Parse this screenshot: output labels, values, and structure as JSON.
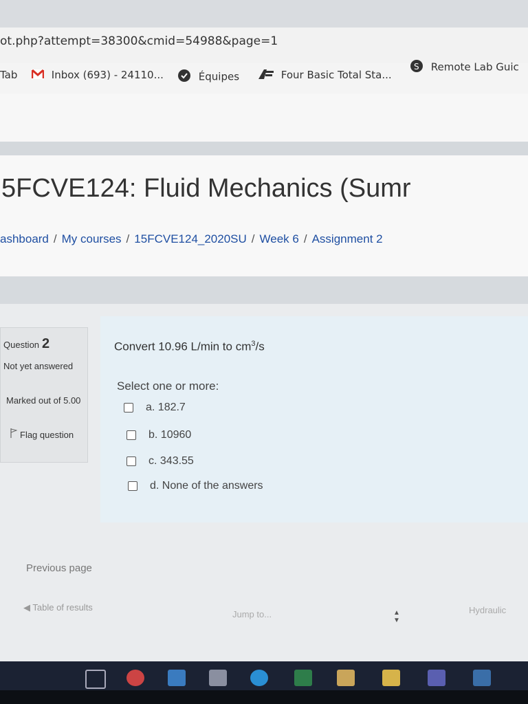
{
  "browser": {
    "url_fragment": "ot.php?attempt=38300&cmid=54988&page=1",
    "bookmarks": [
      {
        "label": "Tab",
        "icon": "none"
      },
      {
        "label": "Inbox (693) - 24110...",
        "icon": "gmail-icon"
      },
      {
        "label": "Équipes",
        "icon": "teams-icon"
      },
      {
        "label": "Four Basic Total Sta...",
        "icon": "bookmark-logo-icon"
      },
      {
        "label": "Remote Lab Guic",
        "icon": "sharepoint-icon"
      }
    ]
  },
  "course": {
    "title": "5FCVE124: Fluid Mechanics (Sumr",
    "breadcrumb": [
      "ashboard",
      "My courses",
      "15FCVE124_2020SU",
      "Week 6",
      "Assignment 2"
    ]
  },
  "question_info": {
    "label": "Question",
    "number": "2",
    "state": "Not yet answered",
    "marks": "Marked out of 5.00",
    "flag": "Flag question"
  },
  "question": {
    "text_before": "Convert 10.96 L/min to cm",
    "superscript": "3",
    "text_after": "/s",
    "prompt": "Select one or more:",
    "options": [
      {
        "label": "a. 182.7",
        "checked": false
      },
      {
        "label": "b. 10960",
        "checked": false
      },
      {
        "label": "c. 343.55",
        "checked": false
      },
      {
        "label": "d. None of the answers",
        "checked": false
      }
    ]
  },
  "navigation": {
    "previous": "Previous page",
    "table_of_results": "Table of results",
    "jump_to": "Jump to...",
    "next_activity": "Hydraulic"
  },
  "taskbar": {
    "icons": [
      "task-view-icon",
      "chrome-icon",
      "mail-icon",
      "r-app-icon",
      "edge-icon",
      "excel-icon",
      "store-icon",
      "folder-icon",
      "teams-icon",
      "photos-icon"
    ]
  },
  "colors": {
    "link": "#1f4fa2",
    "question_bg": "#e6f0f6",
    "taskbar": "#1b2233"
  }
}
